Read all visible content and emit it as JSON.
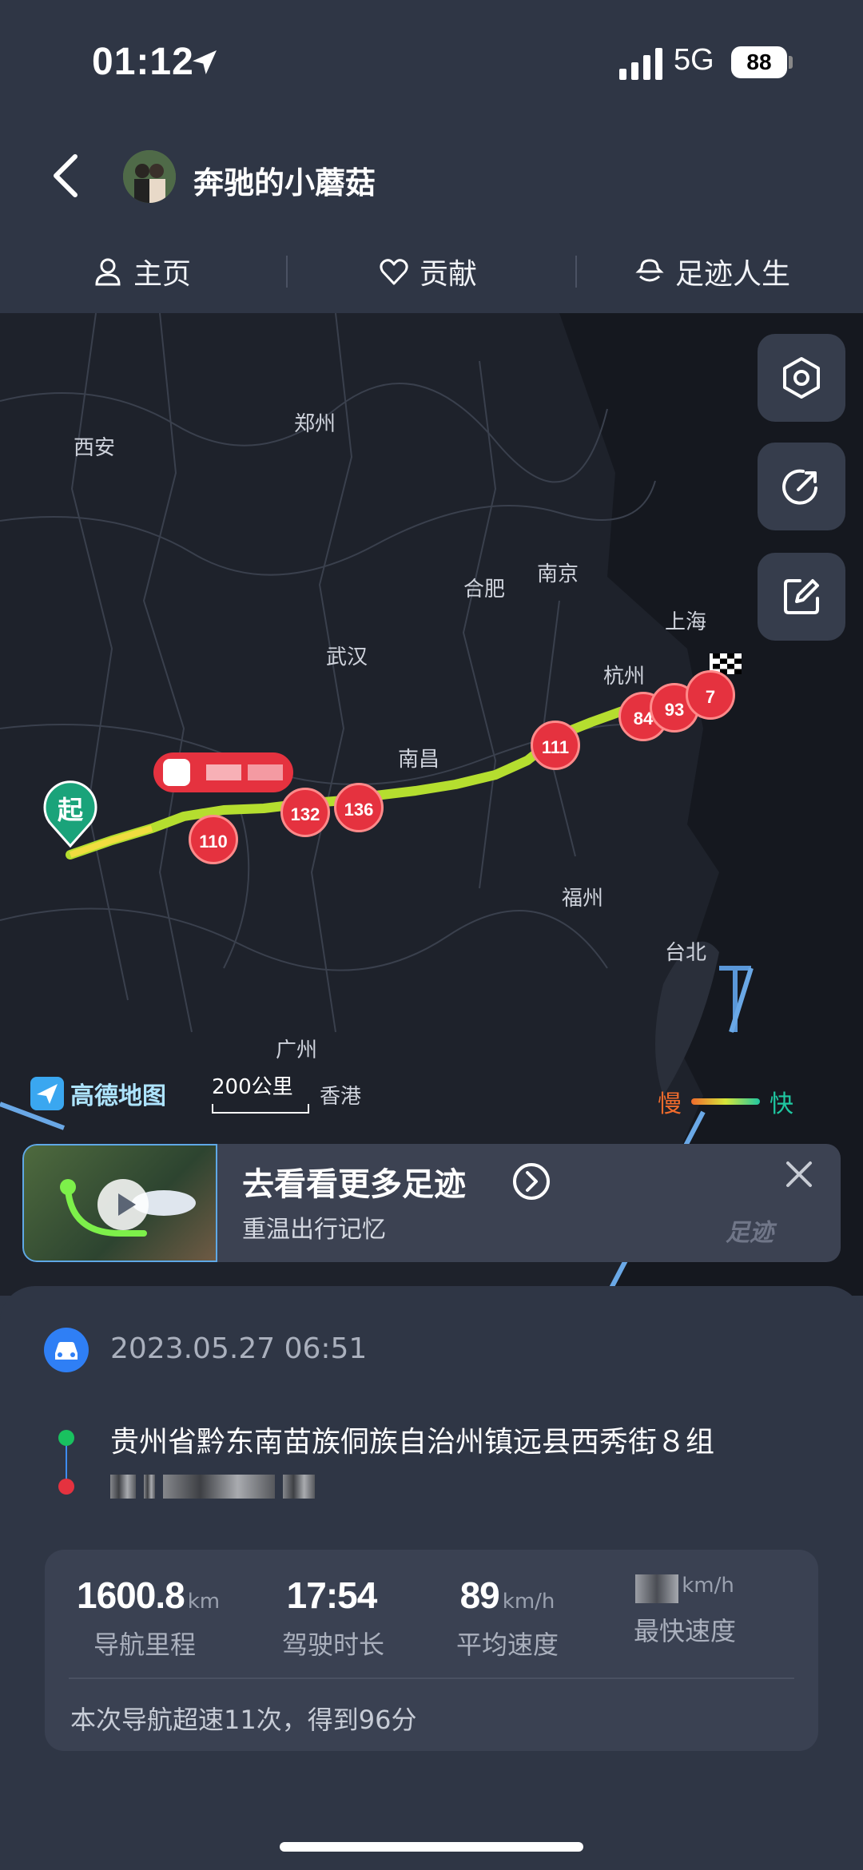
{
  "status_bar": {
    "time": "01:12",
    "network": "5G",
    "battery": "88"
  },
  "header": {
    "username": "奔驰的小蘑菇",
    "back_icon": "chevron-left-icon"
  },
  "tabs": [
    {
      "label": "主页",
      "icon": "user-icon"
    },
    {
      "label": "贡献",
      "icon": "heart-icon"
    },
    {
      "label": "足迹人生",
      "icon": "footprint-icon"
    }
  ],
  "map": {
    "cities": [
      "西安",
      "郑州",
      "合肥",
      "南京",
      "上海",
      "武汉",
      "杭州",
      "南昌",
      "福州",
      "台北",
      "广州"
    ],
    "start_label": "起",
    "speed_markers": [
      "110",
      "132",
      "136",
      "111",
      "84",
      "93",
      "7"
    ],
    "logo": "高德地图",
    "scale": "200公里",
    "hongkong": "香港",
    "legend_slow": "慢",
    "legend_fast": "快",
    "buttons": [
      "settings-icon",
      "share-icon",
      "edit-icon"
    ]
  },
  "banner": {
    "title": "去看看更多足迹",
    "subtitle": "重温出行记忆",
    "watermark": "足迹"
  },
  "trip": {
    "datetime": "2023.05.27 06:51",
    "from": "贵州省黔东南苗族侗族自治州镇远县西秀街８组",
    "stats": [
      {
        "value": "1600.8",
        "unit": "km",
        "label": "导航里程"
      },
      {
        "value": "17:54",
        "unit": "",
        "label": "驾驶时长"
      },
      {
        "value": "89",
        "unit": "km/h",
        "label": "平均速度"
      },
      {
        "value": "",
        "unit": "km/h",
        "label": "最快速度"
      }
    ],
    "note": "本次导航超速11次，得到96分"
  },
  "colors": {
    "accent": "#2f7ff5",
    "route": "#b5de2f",
    "marker": "#e5323f",
    "start": "#1aa37a"
  }
}
